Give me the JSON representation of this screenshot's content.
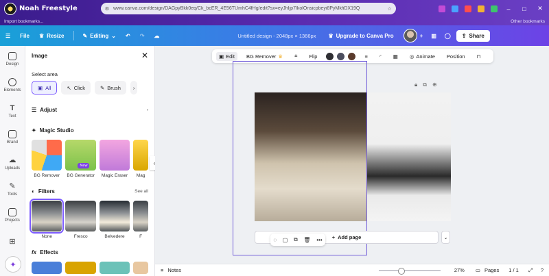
{
  "browser": {
    "brand": "Noah Freestyle",
    "url": "www.canva.com/design/DAGpyBkk0eq/Ck_bcER_4E56TUmhC4fHg/edit?sx=eyJhIjp7IkolOnsicpbeyi8PyMkfiDX19Q",
    "bookmark_left": "Import bookmarks...",
    "bookmark_right": "Other bookmarks"
  },
  "topbar": {
    "file": "File",
    "resize": "Resize",
    "editing": "Editing",
    "design_title": "Untitled design - 2048px × 1366px",
    "upgrade": "Upgrade to Canva Pro",
    "share": "Share"
  },
  "rail": {
    "items": [
      {
        "label": "Design"
      },
      {
        "label": "Elements"
      },
      {
        "label": "Text"
      },
      {
        "label": "Brand"
      },
      {
        "label": "Uploads"
      },
      {
        "label": "Tools"
      },
      {
        "label": "Projects"
      },
      {
        "label": ""
      }
    ]
  },
  "panel": {
    "title": "Image",
    "select_area_label": "Select area",
    "select_modes": [
      {
        "label": "All"
      },
      {
        "label": "Click"
      },
      {
        "label": "Brush"
      }
    ],
    "adjust_label": "Adjust",
    "magic_studio_label": "Magic Studio",
    "magic_items": [
      {
        "label": "BG Remover"
      },
      {
        "label": "BG Generator",
        "badge": "New"
      },
      {
        "label": "Magic Eraser"
      },
      {
        "label": "Mag"
      }
    ],
    "filters_label": "Filters",
    "see_all": "See all",
    "filters": [
      {
        "label": "None"
      },
      {
        "label": "Fresco"
      },
      {
        "label": "Belvedere"
      },
      {
        "label": "F"
      }
    ],
    "effects_label": "Effects"
  },
  "context_bar": {
    "edit": "Edit",
    "bg_remover": "BG Remover",
    "flip": "Flip",
    "animate": "Animate",
    "position": "Position",
    "swatch_colors": [
      "#2f2f33",
      "#4c4e5e",
      "#5a3b2c"
    ]
  },
  "canvas": {
    "add_page": "Add page"
  },
  "footer": {
    "notes": "Notes",
    "zoom": "27%",
    "pages": "Pages",
    "page_count": "1 / 1"
  },
  "colors": {
    "accent": "#7d5cff",
    "topbar_start": "#19a0d8",
    "topbar_end": "#6d42e6"
  }
}
